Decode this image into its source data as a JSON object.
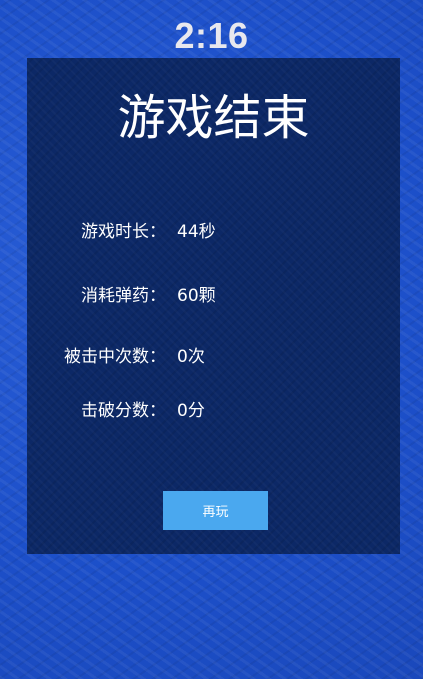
{
  "timer": "2:16",
  "result": {
    "title": "游戏结束",
    "stats": [
      {
        "label": "游戏时长：",
        "value": "44秒"
      },
      {
        "label": "消耗弹药：",
        "value": "60颗"
      },
      {
        "label": "被击中次数：",
        "value": "0次"
      },
      {
        "label": "击破分数：",
        "value": "0分"
      }
    ],
    "replay_label": "再玩"
  }
}
